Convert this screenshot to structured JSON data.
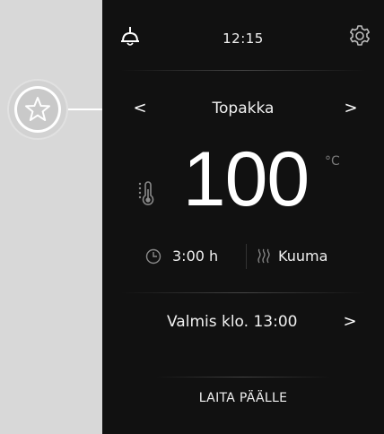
{
  "callout": {
    "icon": "star-icon"
  },
  "status_bar": {
    "hood_icon": "hood-light-icon",
    "time": "12:15",
    "settings_icon": "gear-icon"
  },
  "mode_selector": {
    "prev_label": "<",
    "mode": "Topakka",
    "next_label": ">"
  },
  "temperature": {
    "icon": "thermometer-icon",
    "value": "100",
    "unit": "°C"
  },
  "program_info": {
    "timer_icon": "timer-icon",
    "duration": "3:00 h",
    "heat_icon": "heat-waves-icon",
    "heat_mode": "Kuuma"
  },
  "ready": {
    "label": "Valmis klo. 13:00",
    "chevron": ">"
  },
  "start": {
    "label": "LAITA PÄÄLLE"
  },
  "colors": {
    "screen_background": "#111111",
    "page_background": "#d8d8d8",
    "text": "#f0f0f0",
    "muted": "#7a7a7a"
  }
}
